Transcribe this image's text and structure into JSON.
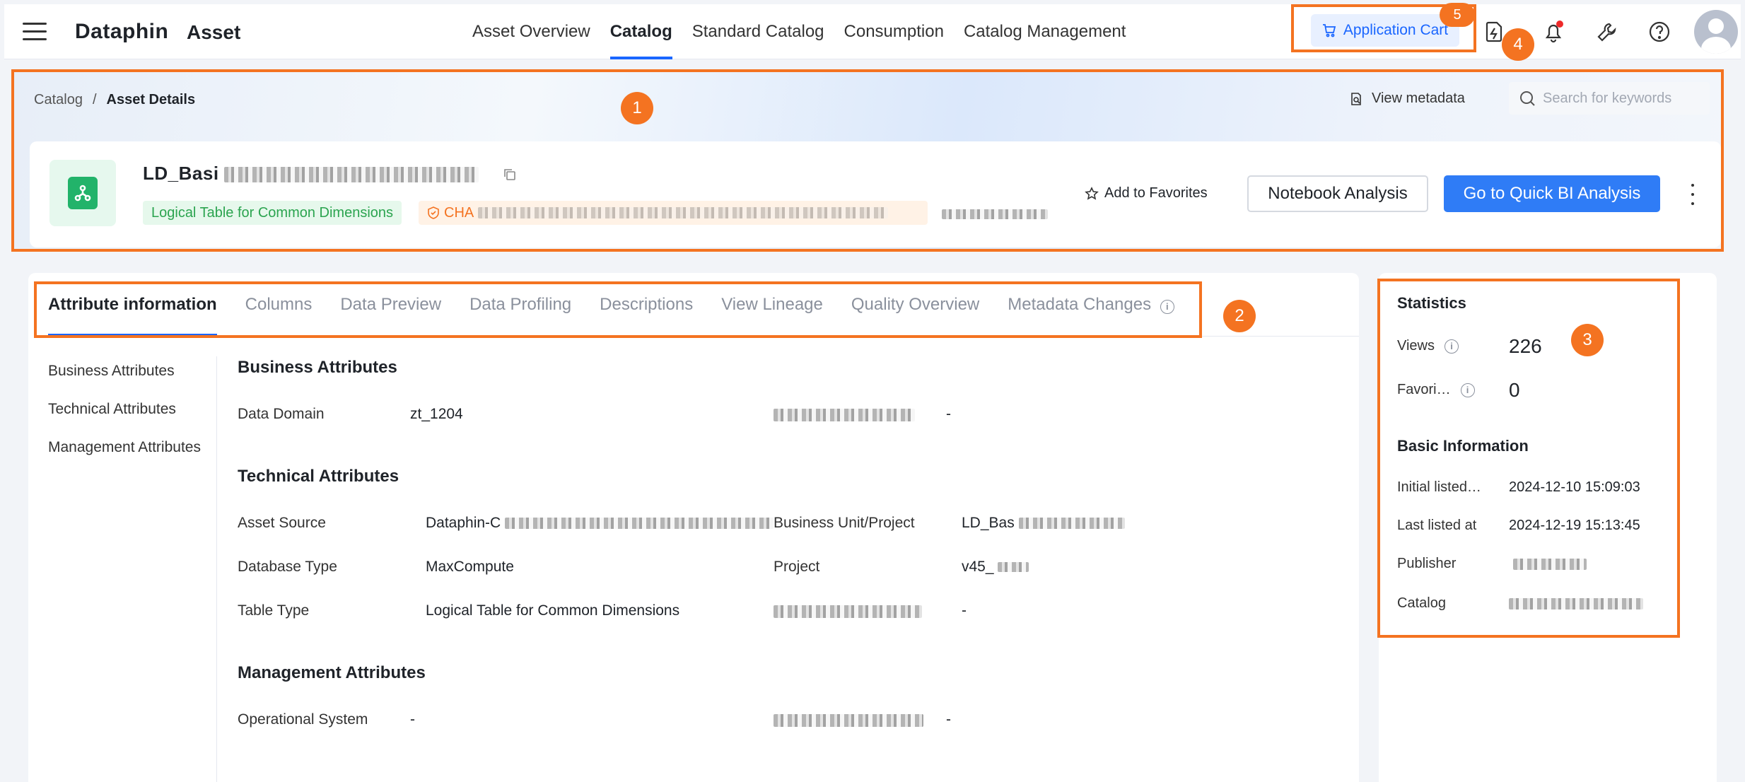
{
  "app": {
    "brand": "Dataphin",
    "module": "Asset"
  },
  "nav": {
    "items": [
      "Asset Overview",
      "Catalog",
      "Standard Catalog",
      "Consumption",
      "Catalog Management"
    ],
    "active": "Catalog"
  },
  "topbar": {
    "cart_label": "Application Cart"
  },
  "breadcrumb": {
    "root": "Catalog",
    "separator": "/",
    "current": "Asset Details"
  },
  "header": {
    "view_metadata": "View metadata",
    "search_placeholder": "Search for keywords",
    "asset_name": "LD_Basi",
    "tag_type": "Logical Table for Common Dimensions",
    "tag_owner_prefix": "CHA",
    "add_favorites": "Add to Favorites",
    "notebook_button": "Notebook Analysis",
    "quickbi_button": "Go to Quick BI Analysis"
  },
  "tabs": [
    "Attribute information",
    "Columns",
    "Data Preview",
    "Data Profiling",
    "Descriptions",
    "View Lineage",
    "Quality Overview",
    "Metadata Changes"
  ],
  "side_nav": [
    "Business Attributes",
    "Technical Attributes",
    "Management Attributes"
  ],
  "business": {
    "title": "Business Attributes",
    "data_domain_label": "Data Domain",
    "data_domain_value": "zt_1204",
    "dash": "-"
  },
  "technical": {
    "title": "Technical Attributes",
    "asset_source_label": "Asset Source",
    "asset_source_value": "Dataphin-C",
    "bu_label": "Business Unit/Project",
    "bu_value": "LD_Bas",
    "db_type_label": "Database Type",
    "db_type_value": "MaxCompute",
    "project_label": "Project",
    "project_value": "v45_",
    "table_type_label": "Table Type",
    "table_type_value": "Logical Table for Common Dimensions",
    "dash": "-"
  },
  "management": {
    "title": "Management Attributes",
    "op_system_label": "Operational System",
    "op_system_value": "-",
    "dash": "-"
  },
  "statistics": {
    "title": "Statistics",
    "views_label": "Views",
    "views_value": "226",
    "favorites_label": "Favori…",
    "favorites_value": "0"
  },
  "basic_info": {
    "title": "Basic Information",
    "initial_label": "Initial listed…",
    "initial_value": "2024-12-10 15:09:03",
    "last_label": "Last listed at",
    "last_value": "2024-12-19 15:13:45",
    "publisher_label": "Publisher",
    "catalog_label": "Catalog"
  },
  "annotations": [
    "1",
    "2",
    "3",
    "4",
    "5"
  ],
  "colors": {
    "accent": "#1a66ff",
    "annotation": "#f47321",
    "primary_button": "#2f7cf6",
    "tag_green": "#2ba44f"
  }
}
